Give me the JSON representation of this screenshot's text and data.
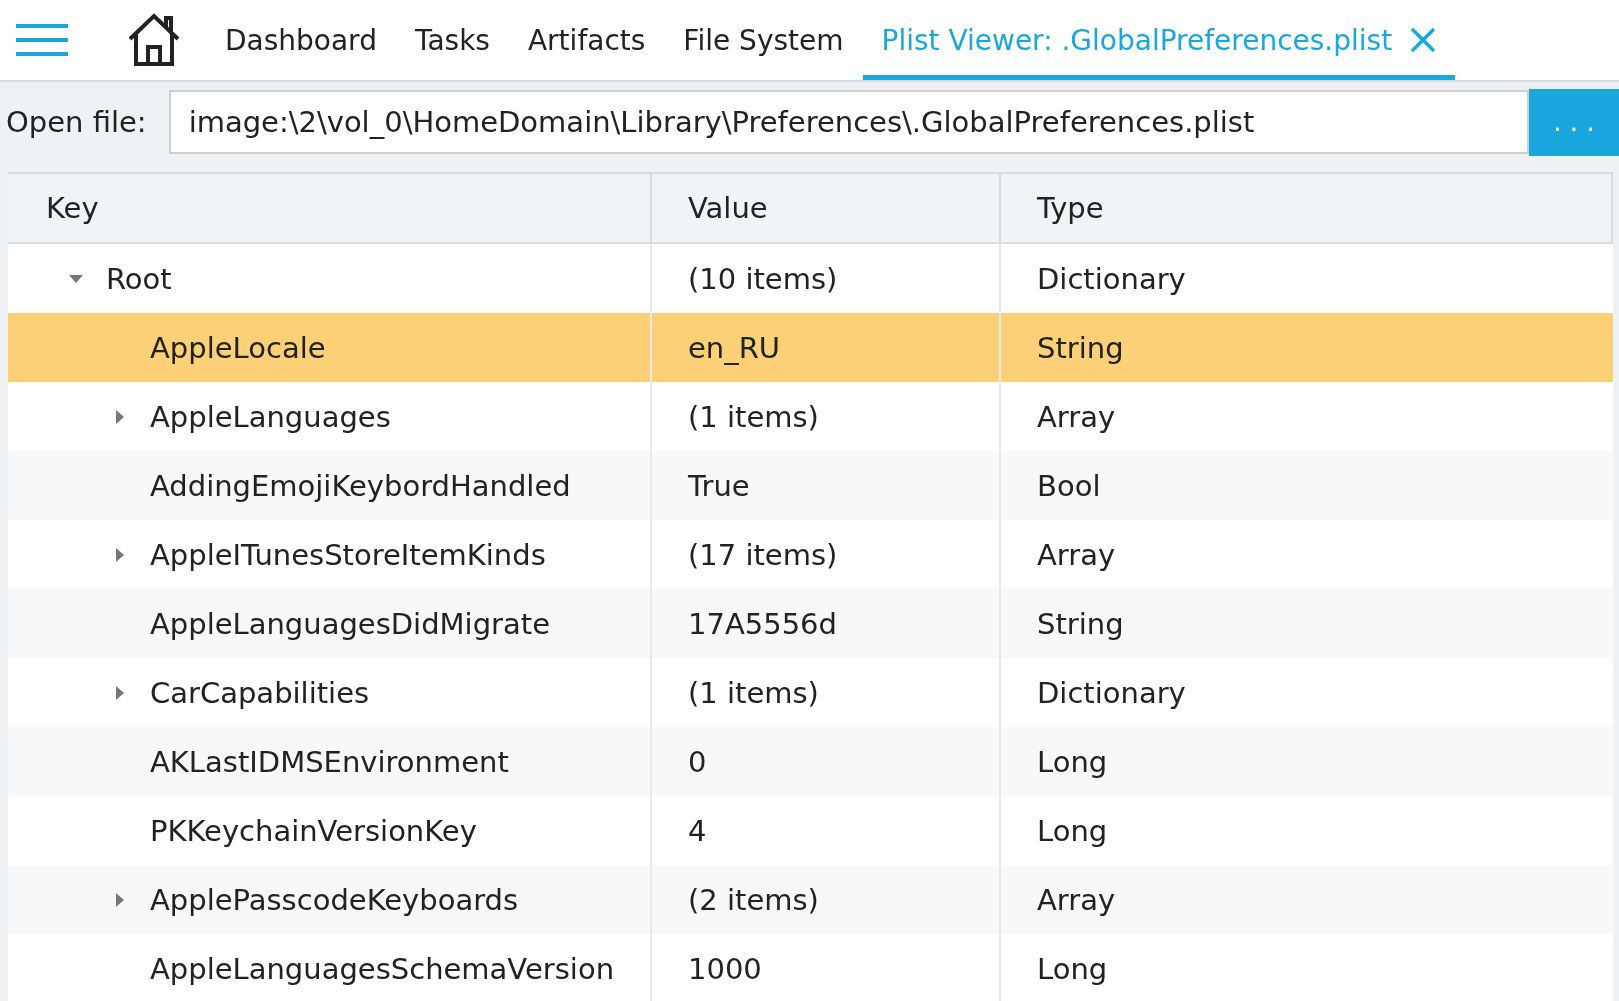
{
  "tabs": [
    {
      "label": "Dashboard",
      "selected": false,
      "closable": false
    },
    {
      "label": "Tasks",
      "selected": false,
      "closable": false
    },
    {
      "label": "Artifacts",
      "selected": false,
      "closable": false
    },
    {
      "label": "File System",
      "selected": false,
      "closable": false
    },
    {
      "label": "Plist Viewer: .GlobalPreferences.plist",
      "selected": true,
      "closable": true
    }
  ],
  "open_file": {
    "label": "Open file:",
    "value": "image:\\2\\vol_0\\HomeDomain\\Library\\Preferences\\.GlobalPreferences.plist",
    "browse_button": ". . ."
  },
  "table": {
    "columns": [
      "Key",
      "Value",
      "Type"
    ],
    "rows": [
      {
        "key": "Root",
        "value": "(10 items)",
        "type": "Dictionary",
        "kind": "container",
        "expanded": true,
        "selected": false,
        "children": [
          {
            "key": "AppleLocale",
            "value": "en_RU",
            "type": "String",
            "kind": "leaf",
            "selected": true
          },
          {
            "key": "AppleLanguages",
            "value": "(1 items)",
            "type": "Array",
            "kind": "container",
            "expanded": false,
            "selected": false
          },
          {
            "key": "AddingEmojiKeybordHandled",
            "value": "True",
            "type": "Bool",
            "kind": "leaf",
            "selected": false
          },
          {
            "key": "AppleITunesStoreItemKinds",
            "value": "(17 items)",
            "type": "Array",
            "kind": "container",
            "expanded": false,
            "selected": false
          },
          {
            "key": "AppleLanguagesDidMigrate",
            "value": "17A5556d",
            "type": "String",
            "kind": "leaf",
            "selected": false
          },
          {
            "key": "CarCapabilities",
            "value": "(1 items)",
            "type": "Dictionary",
            "kind": "container",
            "expanded": false,
            "selected": false
          },
          {
            "key": "AKLastIDMSEnvironment",
            "value": "0",
            "type": "Long",
            "kind": "leaf",
            "selected": false
          },
          {
            "key": "PKKeychainVersionKey",
            "value": "4",
            "type": "Long",
            "kind": "leaf",
            "selected": false
          },
          {
            "key": "ApplePasscodeKeyboards",
            "value": "(2 items)",
            "type": "Array",
            "kind": "container",
            "expanded": false,
            "selected": false
          },
          {
            "key": "AppleLanguagesSchemaVersion",
            "value": "1000",
            "type": "Long",
            "kind": "leaf",
            "selected": false
          }
        ]
      }
    ]
  }
}
